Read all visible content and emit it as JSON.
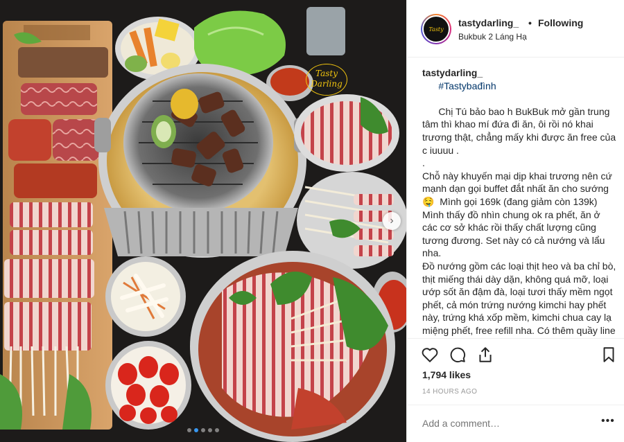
{
  "post": {
    "username": "tastydarling_",
    "follow_separator": "•",
    "follow_status": "Following",
    "location": "Bukbuk 2 Láng Hạ",
    "watermark": "Tasty Darling",
    "caption": {
      "user": "tastydarling_",
      "hashtag": "#Tastybađình",
      "text": "Chị Tú bảo bao h BukBuk mở gần trung tâm thì khao mí đứa đi ăn, ôi rồi nó khai trương thật, chẳng mấy khi được ăn free của c iuuuu .\n.\nChỗ này khuyến mại dịp khai trương nên cứ mạnh dạn gọi buffet đắt nhất ăn cho sướng 🤤  Mình gọi 169k (đang giảm còn 139k) Mình thấy đồ nhìn chung ok ra phết, ăn ở các cơ sở khác rồi thấy chất lượng cũng tương đương. Set này có cả nướng và lẩu nha.\nĐồ nướng gồm các loại thịt heo và ba chỉ bò, thịt miếng thái dày dặn, không quá mỡ, loại ướp sốt ăn đậm đà, loại tươi thấy mềm ngọt phết, cả món trứng nướng kimchi hay phết này, trứng khá xốp mềm, kimchi chua cay lạ miệng phết, free refill nha. Có thêm quầy line panchan và rau củ cho khách chủ động lấy"
    },
    "likes": "1,794 likes",
    "timestamp": "14 HOURS AGO",
    "comment_placeholder": "Add a comment…",
    "more_label": "•••",
    "carousel": {
      "slide_count": 5,
      "active_index": 1
    }
  },
  "icons": {
    "like": "heart-icon",
    "comment": "comment-icon",
    "share": "share-icon",
    "save": "bookmark-icon",
    "next": "chevron-right-icon"
  },
  "colors": {
    "link": "#003569",
    "muted": "#999999",
    "active_dot": "#3897f0",
    "border": "#efefef"
  }
}
